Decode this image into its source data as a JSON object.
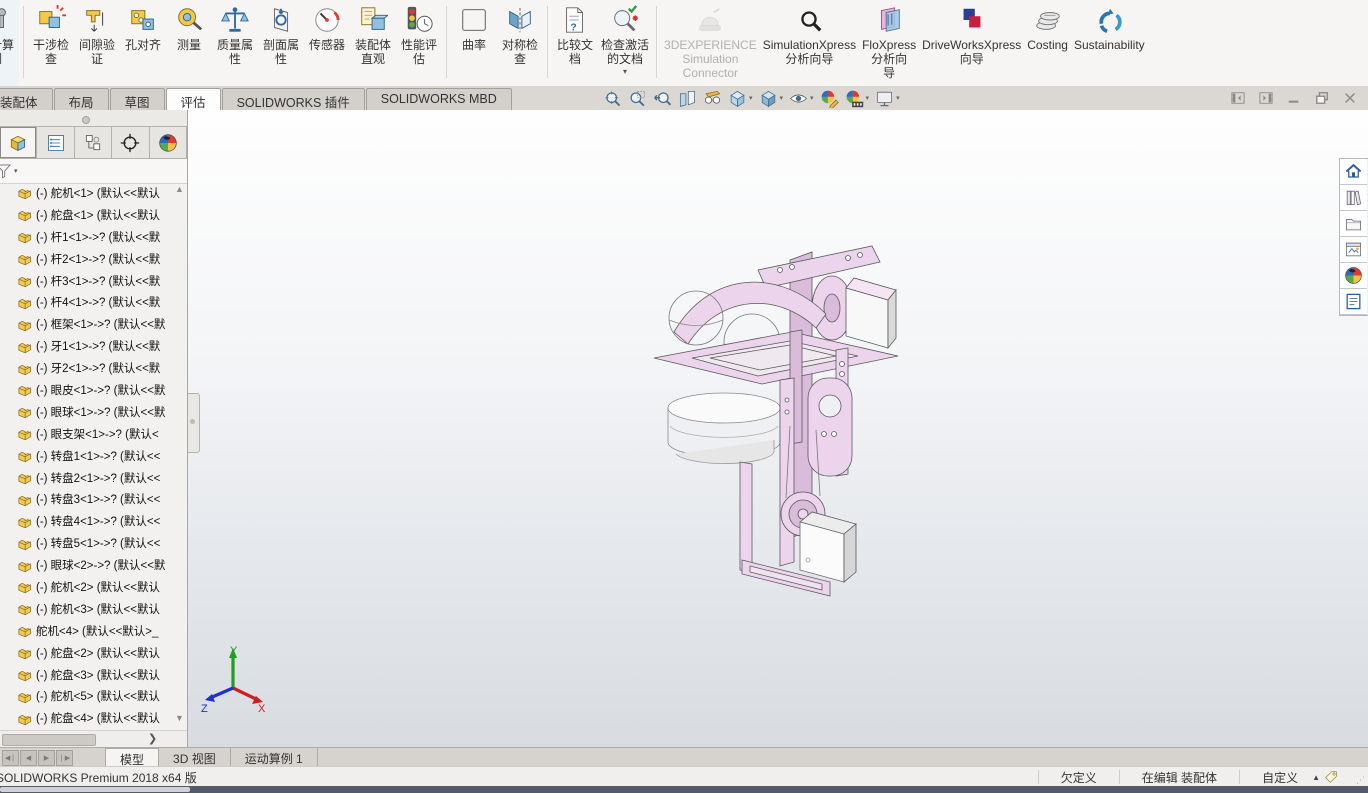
{
  "ribbon": {
    "items": [
      {
        "name": "design-study-button",
        "icon": "design-study-icon",
        "label": "设计算\n例",
        "dropdown": true,
        "cut": true
      },
      {
        "name": "ribbon-separator",
        "separator": true,
        "inter": "false"
      },
      {
        "name": "interference-check-button",
        "icon": "interference-check-icon",
        "label": "干涉检\n查"
      },
      {
        "name": "clearance-verify-button",
        "icon": "clearance-verify-icon",
        "label": "间隙验\n证"
      },
      {
        "name": "hole-alignment-button",
        "icon": "hole-alignment-icon",
        "label": "孔对齐"
      },
      {
        "name": "measure-button",
        "icon": "measure-icon",
        "label": "测量"
      },
      {
        "name": "mass-properties-button",
        "icon": "mass-properties-icon",
        "label": "质量属\n性"
      },
      {
        "name": "section-properties-button",
        "icon": "section-properties-icon",
        "label": "剖面属\n性"
      },
      {
        "name": "sensor-button",
        "icon": "sensor-icon",
        "label": "传感器"
      },
      {
        "name": "assembly-visualization-button",
        "icon": "assembly-visualization-icon",
        "label": "装配体\n直观"
      },
      {
        "name": "performance-evaluation-button",
        "icon": "performance-evaluation-icon",
        "label": "性能评\n估"
      },
      {
        "name": "ribbon-separator",
        "separator": true,
        "inter": "false"
      },
      {
        "name": "curvature-button",
        "icon": "curvature-icon",
        "label": "曲率"
      },
      {
        "name": "symmetry-check-button",
        "icon": "symmetry-check-icon",
        "label": "对称检\n查"
      },
      {
        "name": "ribbon-separator",
        "separator": true,
        "inter": "false"
      },
      {
        "name": "compare-documents-button",
        "icon": "compare-documents-icon",
        "label": "比较文\n档"
      },
      {
        "name": "check-active-document-button",
        "icon": "check-active-document-icon",
        "label": "检查激活\n的文档",
        "dropdown": true
      },
      {
        "name": "ribbon-separator",
        "separator": true,
        "inter": "false"
      },
      {
        "name": "3dexperience-connector-button",
        "icon": "dexperience-icon",
        "label": "3DEXPERIENCE\nSimulation\nConnector",
        "disabled": true
      },
      {
        "name": "simulationxpress-button",
        "icon": "simulationxpress-icon",
        "label": "SimulationXpress\n分析向导"
      },
      {
        "name": "floxpress-button",
        "icon": "floxpress-icon",
        "label": "FloXpress\n分析向\n导"
      },
      {
        "name": "driveworksxpress-button",
        "icon": "driveworksxpress-icon",
        "label": "DriveWorksXpress\n向导"
      },
      {
        "name": "costing-button",
        "icon": "costing-icon",
        "label": "Costing"
      },
      {
        "name": "sustainability-button",
        "icon": "sustainability-icon",
        "label": "Sustainability"
      }
    ]
  },
  "command_tabs": [
    {
      "name": "tab-assembly",
      "label": "装配体"
    },
    {
      "name": "tab-layout",
      "label": "布局"
    },
    {
      "name": "tab-sketch",
      "label": "草图"
    },
    {
      "name": "tab-evaluate",
      "label": "评估",
      "active": true
    },
    {
      "name": "tab-solidworks-addins",
      "label": "SOLIDWORKS 插件"
    },
    {
      "name": "tab-solidworks-mbd",
      "label": "SOLIDWORKS MBD"
    }
  ],
  "view_toolbar": {
    "buttons": [
      {
        "name": "zoom-to-fit-icon",
        "icon": "zoom-to-fit-icon"
      },
      {
        "name": "zoom-to-area-icon",
        "icon": "zoom-to-area-icon"
      },
      {
        "name": "previous-view-icon",
        "icon": "previous-view-icon"
      },
      {
        "name": "section-view-icon",
        "icon": "section-view-icon"
      },
      {
        "name": "hide-show-annotations-icon",
        "icon": "hide-show-annotations-icon"
      },
      {
        "name": "view-orientation-icon",
        "icon": "view-orientation-icon",
        "dropdown": true
      },
      {
        "name": "display-style-icon",
        "icon": "display-style-icon",
        "dropdown": true
      },
      {
        "name": "hide-show-items-icon",
        "icon": "hide-show-items-icon",
        "dropdown": true
      },
      {
        "name": "edit-appearance-icon",
        "icon": "edit-appearance-icon"
      },
      {
        "name": "apply-scene-icon",
        "icon": "apply-scene-icon",
        "dropdown": true
      },
      {
        "name": "view-settings-icon",
        "icon": "view-settings-icon",
        "dropdown": true
      }
    ]
  },
  "window_controls": [
    {
      "name": "collapse-left-pane-button",
      "icon": "pane-left-icon"
    },
    {
      "name": "expand-right-pane-button",
      "icon": "pane-right-icon"
    },
    {
      "name": "minimize-button",
      "icon": "minimize-icon"
    },
    {
      "name": "restore-button",
      "icon": "restore-icon"
    },
    {
      "name": "close-button",
      "icon": "close-icon"
    }
  ],
  "left_panel": {
    "manager_tabs": [
      {
        "name": "featuremanager-tree-tab",
        "icon": "feature-tree-icon",
        "active": true
      },
      {
        "name": "propertymanager-tab",
        "icon": "property-manager-icon"
      },
      {
        "name": "configurationmanager-tab",
        "icon": "configuration-manager-icon"
      },
      {
        "name": "dimxpertmanager-tab",
        "icon": "dimxpert-icon"
      },
      {
        "name": "displaymanager-tab",
        "icon": "ball-icon"
      }
    ],
    "filter_icon": "funnel-icon",
    "tree_icon": "assembly-component-icon",
    "tree_items": [
      "(-) 舵机<1> (默认<<默认",
      "(-) 舵盘<1> (默认<<默认",
      "(-) 杆1<1>->? (默认<<默",
      "(-) 杆2<1>->? (默认<<默",
      "(-) 杆3<1>->? (默认<<默",
      "(-) 杆4<1>->? (默认<<默",
      "(-) 框架<1>->? (默认<<默",
      "(-) 牙1<1>->? (默认<<默",
      "(-) 牙2<1>->? (默认<<默",
      "(-) 眼皮<1>->? (默认<<默",
      "(-) 眼球<1>->? (默认<<默",
      "(-) 眼支架<1>->? (默认<",
      "(-) 转盘1<1>->? (默认<<",
      "(-) 转盘2<1>->? (默认<<",
      "(-) 转盘3<1>->? (默认<<",
      "(-) 转盘4<1>->? (默认<<",
      "(-) 转盘5<1>->? (默认<<",
      "(-) 眼球<2>->? (默认<<默",
      "(-) 舵机<2> (默认<<默认",
      "(-) 舵机<3> (默认<<默认",
      "舵机<4> (默认<<默认>_",
      "(-) 舵盘<2> (默认<<默认",
      "(-) 舵盘<3> (默认<<默认",
      "(-) 舵机<5> (默认<<默认",
      "(-) 舵盘<4> (默认<<默认"
    ]
  },
  "viewport": {
    "triad": {
      "x": "X",
      "y": "Y",
      "z": "Z"
    }
  },
  "task_pane": [
    {
      "name": "solidworks-resources-button",
      "icon": "home-icon"
    },
    {
      "name": "design-library-button",
      "icon": "design-library-icon"
    },
    {
      "name": "file-explorer-button",
      "icon": "file-explorer-icon"
    },
    {
      "name": "view-palette-button",
      "icon": "view-palette-icon"
    },
    {
      "name": "appearances-scenes-button",
      "icon": "ball-icon"
    },
    {
      "name": "custom-properties-button",
      "icon": "custom-properties-icon"
    }
  ],
  "bottom_bar": {
    "nav": [
      {
        "name": "first-tab-button",
        "glyph": "◀❘"
      },
      {
        "name": "prev-tab-button",
        "glyph": "◀"
      },
      {
        "name": "next-tab-button",
        "glyph": "▶"
      },
      {
        "name": "last-tab-button",
        "glyph": "❘▶"
      }
    ],
    "tabs": [
      {
        "name": "model-tab",
        "label": "模型",
        "active": true
      },
      {
        "name": "3d-views-tab",
        "label": "3D 视图"
      },
      {
        "name": "motion-study-tab",
        "label": "运动算例 1"
      }
    ]
  },
  "status_bar": {
    "product": "SOLIDWORKS Premium 2018 x64 版",
    "fields": [
      {
        "name": "status-underdefined",
        "label": "欠定义"
      },
      {
        "name": "status-editing",
        "label": "在编辑 装配体"
      },
      {
        "name": "status-units",
        "label": "自定义",
        "dropdown": true
      }
    ]
  },
  "colors": {
    "model_pink": "#ecd4ec",
    "model_pink_shade": "#d9bcd9",
    "model_white": "#f8f8f8",
    "tree_icon_yellow": "#f0cc55",
    "triad_x": "#cc2020",
    "triad_y": "#1f9e1f",
    "triad_z": "#2030c8"
  }
}
